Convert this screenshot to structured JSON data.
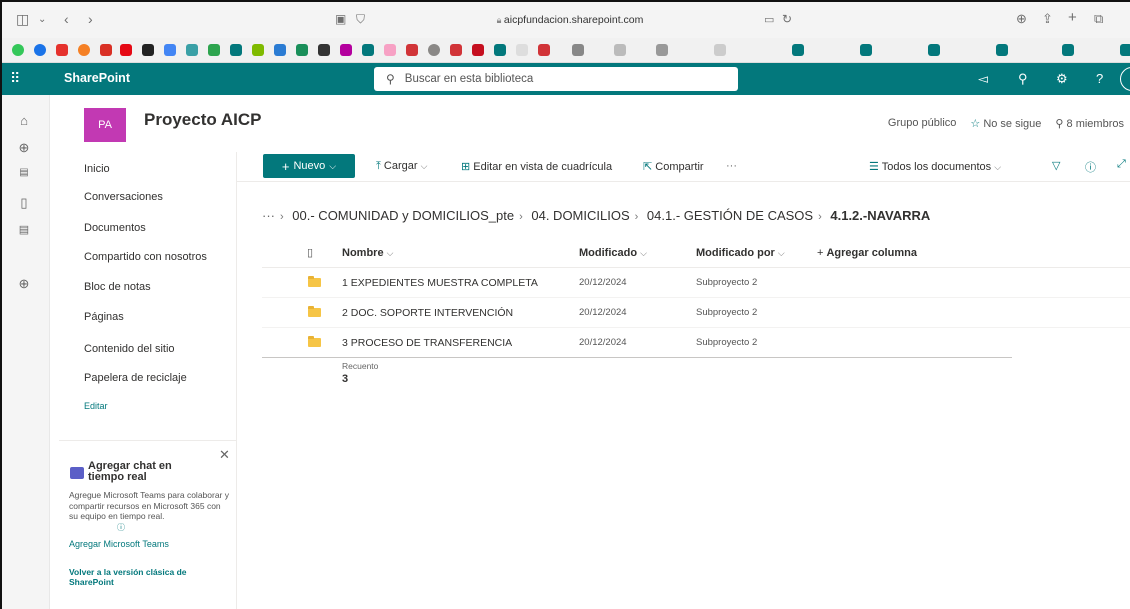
{
  "browser": {
    "url": "aicpfundacion.sharepoint.com"
  },
  "suite": {
    "app_name": "SharePoint",
    "search_placeholder": "Buscar en esta biblioteca"
  },
  "site": {
    "logo_text": "PA",
    "title": "Proyecto AICP",
    "visibility": "Grupo público",
    "follow_label": "No se sigue",
    "members_label": "8 miembros"
  },
  "nav": {
    "items": [
      "Inicio",
      "Conversaciones",
      "Documentos",
      "Compartido con nosotros",
      "Bloc de notas",
      "Páginas",
      "Contenido del sitio",
      "Papelera de reciclaje"
    ],
    "edit_label": "Editar"
  },
  "chat_promo": {
    "title": "Agregar chat en tiempo real",
    "body": "Agregue Microsoft Teams para colaborar y compartir recursos en Microsoft 365 con su equipo en tiempo real.",
    "link": "Agregar Microsoft Teams",
    "classic_link": "Volver a la versión clásica de SharePoint"
  },
  "commands": {
    "new": "Nuevo",
    "upload": "Cargar",
    "grid_edit": "Editar en vista de cuadrícula",
    "share": "Compartir",
    "more": "···",
    "view": "Todos los documentos"
  },
  "breadcrumb": {
    "ellipsis": "···",
    "items": [
      "00.- COMUNIDAD y DOMICILIOS_pte",
      "04. DOMICILIOS",
      "04.1.- GESTIÓN DE CASOS"
    ],
    "current": "4.1.2.-NAVARRA"
  },
  "table": {
    "columns": [
      "Nombre",
      "Modificado",
      "Modificado por",
      "Agregar columna"
    ],
    "rows": [
      {
        "name": "1 EXPEDIENTES MUESTRA COMPLETA",
        "modified": "20/12/2024",
        "modified_by": "Subproyecto 2"
      },
      {
        "name": "2 DOC. SOPORTE INTERVENCIÓN",
        "modified": "20/12/2024",
        "modified_by": "Subproyecto 2"
      },
      {
        "name": "3 PROCESO DE TRANSFERENCIA",
        "modified": "20/12/2024",
        "modified_by": "Subproyecto 2"
      }
    ],
    "count_label": "Recuento",
    "count_value": "3"
  },
  "colors": {
    "brand": "#03787c",
    "site_logo": "#c239b3",
    "folder": "#f6c546"
  }
}
